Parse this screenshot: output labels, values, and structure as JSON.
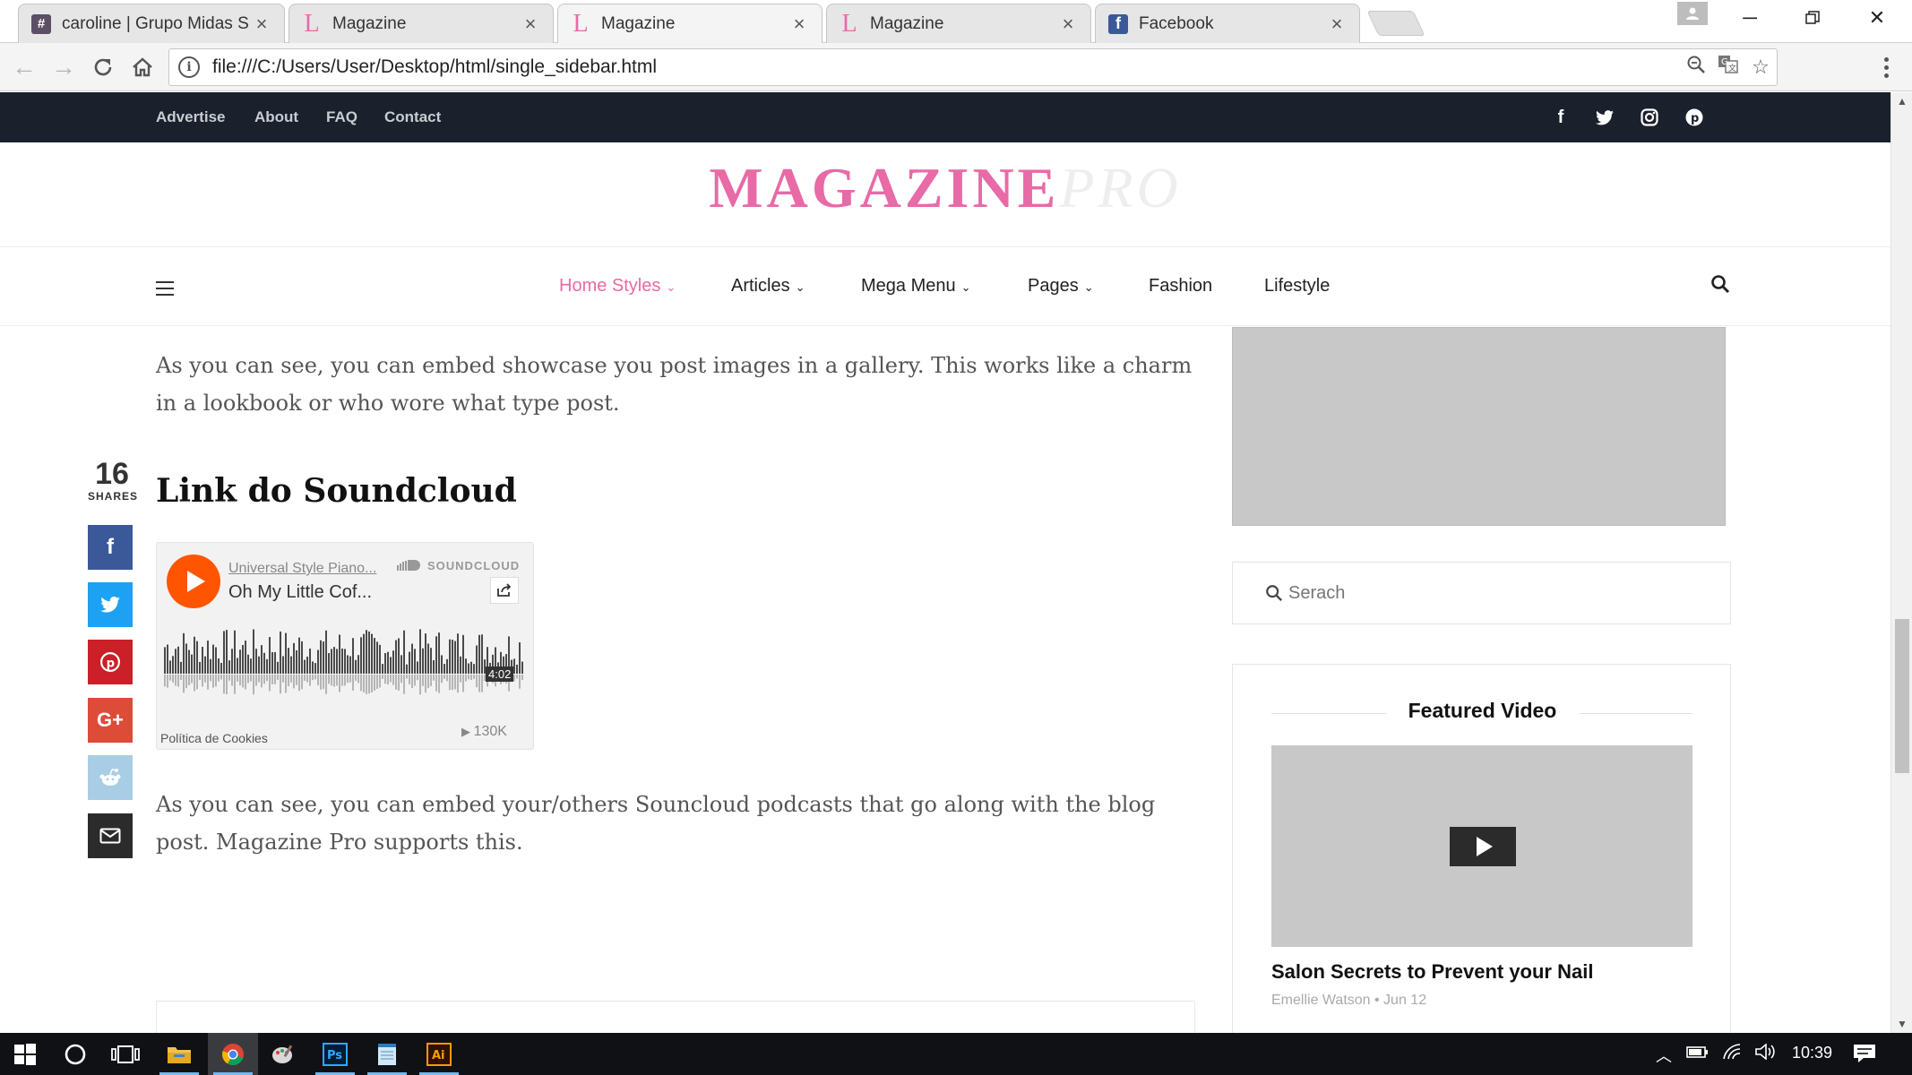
{
  "browser": {
    "tabs": [
      {
        "title": "caroline | Grupo Midas S",
        "favicon": "hash-icon",
        "active": false
      },
      {
        "title": "Magazine",
        "favicon": "magazine-l-icon",
        "active": false
      },
      {
        "title": "Magazine",
        "favicon": "magazine-l-icon",
        "active": true
      },
      {
        "title": "Magazine",
        "favicon": "magazine-l-icon",
        "active": false
      },
      {
        "title": "Facebook",
        "favicon": "facebook-icon",
        "active": false
      }
    ],
    "url": "file:///C:/Users/User/Desktop/html/single_sidebar.html"
  },
  "topbar": {
    "links": [
      "Advertise",
      "About",
      "FAQ",
      "Contact"
    ],
    "social": [
      "facebook-icon",
      "twitter-icon",
      "instagram-icon",
      "pinterest-icon"
    ]
  },
  "logo": {
    "main": "MAGAZINE",
    "suffix": "PRO",
    "accent": "#e86aa6"
  },
  "nav": {
    "items": [
      {
        "label": "Home Styles",
        "dropdown": true,
        "active": true
      },
      {
        "label": "Articles",
        "dropdown": true
      },
      {
        "label": "Mega Menu",
        "dropdown": true
      },
      {
        "label": "Pages",
        "dropdown": true
      },
      {
        "label": "Fashion",
        "dropdown": false
      },
      {
        "label": "Lifestyle",
        "dropdown": false
      }
    ]
  },
  "article": {
    "para1": "As you can see, you can embed showcase you post images in a gallery. This works like a charm in a lookbook or who wore what type post.",
    "heading": "Link do Soundcloud",
    "para2": "As you can see, you can embed your/others Souncloud podcasts that go along with the blog post. Magazine Pro supports this."
  },
  "share": {
    "count": "16",
    "label": "SHARES",
    "buttons": [
      {
        "name": "facebook",
        "color": "#3b5998"
      },
      {
        "name": "twitter",
        "color": "#1da1f2"
      },
      {
        "name": "pinterest",
        "color": "#cb2027"
      },
      {
        "name": "google-plus",
        "color": "#dd4b39"
      },
      {
        "name": "reddit",
        "color": "#a9cde4"
      },
      {
        "name": "email",
        "color": "#2b2b2b"
      }
    ]
  },
  "soundcloud": {
    "artist": "Universal Style Piano...",
    "track": "Oh My Little Cof...",
    "brand": "SOUNDCLOUD",
    "duration": "4:02",
    "cookie": "Política de Cookies",
    "plays": "130K",
    "accent": "#ff5500"
  },
  "sidebar": {
    "search_placeholder": "Serach",
    "featured_title": "Featured Video",
    "video_title": "Salon Secrets to Prevent your Nail",
    "video_meta": "Emellie Watson • Jun 12"
  },
  "taskbar": {
    "time": "10:39"
  }
}
